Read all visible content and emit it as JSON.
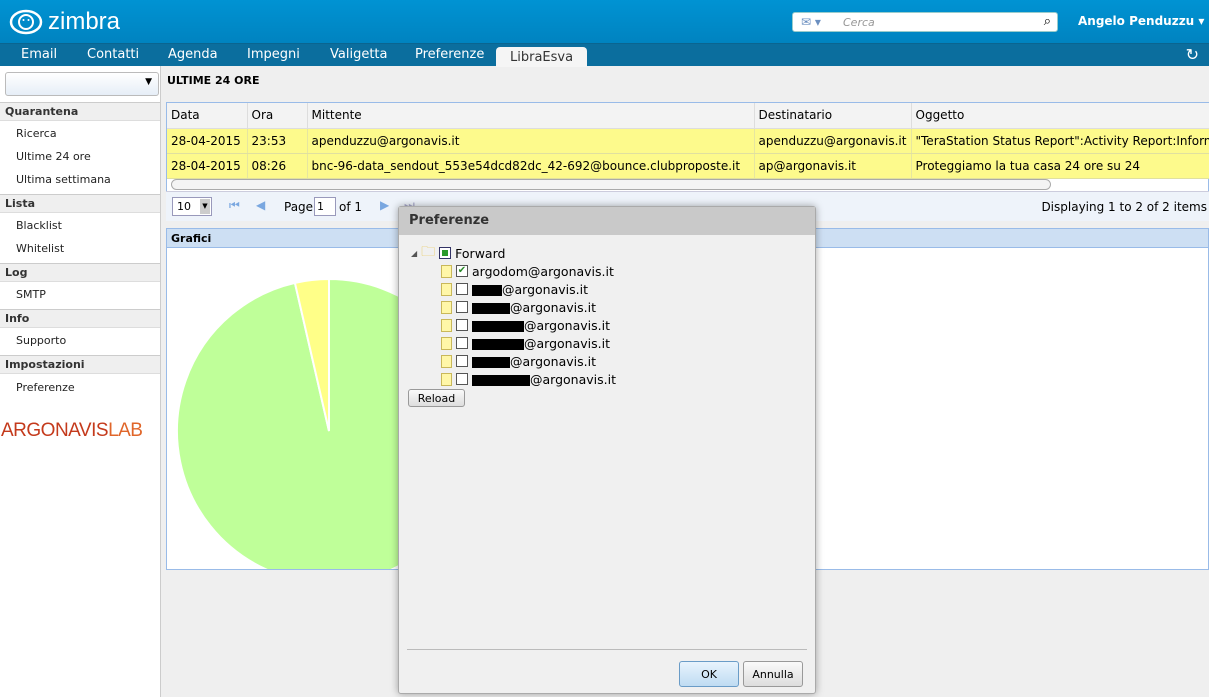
{
  "app": {
    "logo": "zimbra",
    "user": "Angelo Penduzzu",
    "search_placeholder": "Cerca"
  },
  "nav": {
    "tabs": [
      "Email",
      "Contatti",
      "Agenda",
      "Impegni",
      "Valigetta",
      "Preferenze",
      "LibraEsva"
    ],
    "active": "LibraEsva"
  },
  "sidebar": {
    "sections": [
      {
        "title": "Quarantena",
        "items": [
          "Ricerca",
          "Ultime 24 ore",
          "Ultima settimana"
        ]
      },
      {
        "title": "Lista",
        "items": [
          "Blacklist",
          "Whitelist"
        ]
      },
      {
        "title": "Log",
        "items": [
          "SMTP"
        ]
      },
      {
        "title": "Info",
        "items": [
          "Supporto"
        ]
      },
      {
        "title": "Impostazioni",
        "items": [
          "Preferenze"
        ]
      }
    ],
    "brand": "ARGONAVISLAB"
  },
  "main": {
    "title": "ULTIME 24 ORE",
    "columns": [
      "Data",
      "Ora",
      "Mittente",
      "Destinatario",
      "Oggetto"
    ],
    "rows": [
      [
        "28-04-2015",
        "23:53",
        "apenduzzu@argonavis.it",
        "apenduzzu@argonavis.it",
        "\"TeraStation Status Report\":Activity Report:Inform"
      ],
      [
        "28-04-2015",
        "08:26",
        "bnc-96-data_sendout_553e54dcd82dc_42-692@bounce.clubproposte.it",
        "ap@argonavis.it",
        "Proteggiamo la tua casa 24 ore su 24"
      ]
    ],
    "pager": {
      "page_size": "10",
      "page_label": "Page",
      "page": "1",
      "of": "of 1",
      "displaying": "Displaying 1 to 2 of 2 items"
    },
    "charts_title": "Grafici"
  },
  "chart_data": {
    "type": "pie",
    "values": [
      96.4,
      3.6
    ],
    "colors": [
      "#bfff99",
      "#ffff88"
    ]
  },
  "dialog": {
    "title": "Preferenze",
    "root": "Forward",
    "items": [
      {
        "text": "argodom@argonavis.it",
        "checked": true
      },
      {
        "text": "@argonavis.it",
        "checked": false
      },
      {
        "text": "@argonavis.it",
        "checked": false
      },
      {
        "text": "@argonavis.it",
        "checked": false
      },
      {
        "text": "@argonavis.it",
        "checked": false
      },
      {
        "text": "@argonavis.it",
        "checked": false
      },
      {
        "text": "@argonavis.it",
        "checked": false
      }
    ],
    "reload": "Reload",
    "ok": "OK",
    "cancel": "Annulla"
  }
}
